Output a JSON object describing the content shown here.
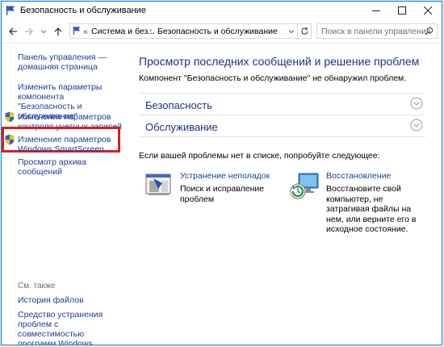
{
  "window": {
    "title": "Безопасность и обслуживание",
    "minimize_icon": "minimize-icon",
    "maximize_icon": "maximize-icon",
    "close_icon": "close-icon"
  },
  "navigation": {
    "back_icon": "arrow-left-icon",
    "forward_icon": "arrow-right-icon",
    "recent_icon": "chevron-down-icon",
    "up_icon": "arrow-up-icon",
    "breadcrumb_overflow": "«",
    "breadcrumb": [
      "Система и без...",
      "Безопасность и обслуживание"
    ],
    "refresh_icon": "refresh-icon",
    "dropdown_icon": "chevron-down-icon",
    "search_placeholder": "Поиск в панели управления"
  },
  "sidebar": {
    "home_link": [
      "Панель управления —",
      "домашняя страница"
    ],
    "links": [
      {
        "lines": [
          "Изменить параметры",
          "компонента \"Безопасность и",
          "обслуживание\""
        ],
        "icon": ""
      },
      {
        "lines": [
          "Изменение параметров",
          "контроля учетных записей"
        ],
        "icon": "shield-icon"
      },
      {
        "lines": [
          "Изменение параметров",
          "Windows SmartScreen"
        ],
        "icon": "shield-icon"
      },
      {
        "lines": [
          "Просмотр архива сообщений"
        ],
        "icon": ""
      }
    ],
    "see_also_label": "См. также",
    "see_also": [
      {
        "lines": [
          "История файлов"
        ]
      },
      {
        "lines": [
          "Средство устранения",
          "проблем с совместимостью",
          "программ Windows"
        ]
      }
    ]
  },
  "main": {
    "title": "Просмотр последних сообщений и решение проблем",
    "subtitle": "Компонент \"Безопасность и обслуживание\" не обнаружил проблем.",
    "sections": [
      "Безопасность",
      "Обслуживание"
    ],
    "hint": "Если вашей проблемы нет в списке, попробуйте следующее:",
    "tasks": [
      {
        "title": "Устранение неполадок",
        "desc": [
          "Поиск и исправление",
          "проблем"
        ],
        "icon": "troubleshoot-icon"
      },
      {
        "title": "Восстановление",
        "desc": [
          "Восстановите свой",
          "компьютер, не",
          "затрагивая файлы на",
          "нем, или верните его в",
          "исходное состояние."
        ],
        "icon": "recovery-icon"
      }
    ]
  },
  "colors": {
    "link": "#1a3e99",
    "heading": "#1e3287",
    "highlight": "#d32027",
    "window_border": "#1883d7"
  }
}
